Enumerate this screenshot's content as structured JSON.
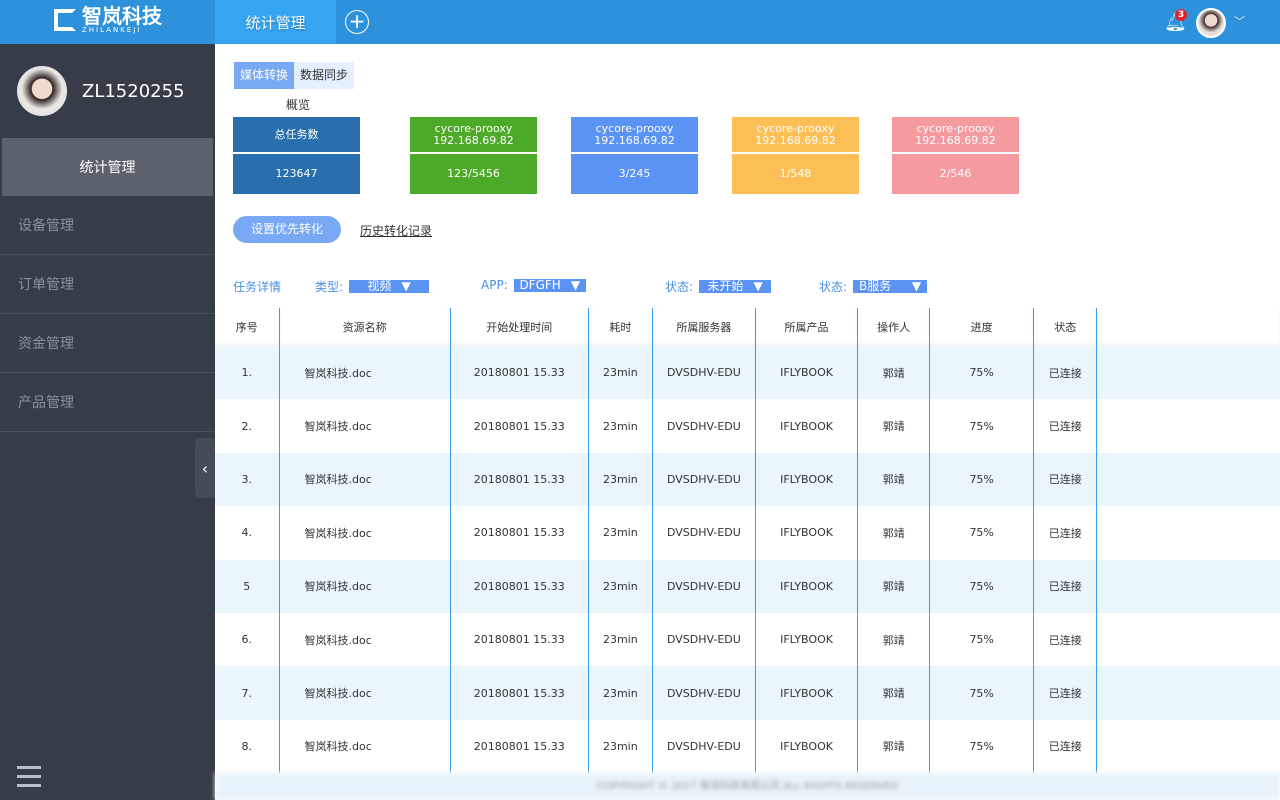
{
  "header": {
    "logo_text": "智岚科技",
    "logo_sub": "ZHILANKEJI",
    "active_tab": "统计管理",
    "notification_count": "3",
    "colors": {
      "bar": "#2d91db",
      "active_tab": "#36a6f2"
    }
  },
  "sidebar": {
    "username": "ZL1520255",
    "items": [
      {
        "label": "统计管理",
        "active": true
      },
      {
        "label": "设备管理"
      },
      {
        "label": "订单管理"
      },
      {
        "label": "资金管理"
      },
      {
        "label": "产品管理"
      }
    ]
  },
  "subtabs": [
    {
      "label": "媒体转换",
      "active": true
    },
    {
      "label": "数据同步"
    }
  ],
  "overview": {
    "label": "概览",
    "cards": [
      {
        "top": "总任务数",
        "top2": "",
        "bottom": "123647",
        "color": "#2a6fad"
      },
      {
        "top": "cycore-prooxy",
        "top2": "192.168.69.82",
        "bottom": "123/5456",
        "color": "#4caa28"
      },
      {
        "top": "cycore-prooxy",
        "top2": "192.168.69.82",
        "bottom": "3/245",
        "color": "#5b93f5"
      },
      {
        "top": "cycore-prooxy",
        "top2": "192.168.69.82",
        "bottom": "1/548",
        "color": "#fbbf55"
      },
      {
        "top": "cycore-prooxy",
        "top2": "192.168.69.82",
        "bottom": "2/546",
        "color": "#f59ba0"
      }
    ]
  },
  "actions": {
    "priority_button": "设置优先转化",
    "history_link": "历史转化记录"
  },
  "filters": {
    "title": "任务详情",
    "items": [
      {
        "label": "类型:",
        "value": "视频"
      },
      {
        "label": "APP:",
        "value": "DFGFH"
      },
      {
        "label": "状态:",
        "value": "未开始"
      },
      {
        "label": "状态:",
        "value": "B服务器"
      }
    ]
  },
  "table": {
    "columns": [
      "序号",
      "资源名称",
      "开始处理时间",
      "耗时",
      "所属服务器",
      "所属产品",
      "操作人",
      "进度",
      "状态",
      ""
    ],
    "rows": [
      [
        "1.",
        "智岚科技.doc",
        "20180801 15.33",
        "23min",
        "DVSDHV-EDU",
        "IFLYBOOK",
        "郭靖",
        "75%",
        "已连接",
        ""
      ],
      [
        "2.",
        "智岚科技.doc",
        "20180801 15.33",
        "23min",
        "DVSDHV-EDU",
        "IFLYBOOK",
        "郭靖",
        "75%",
        "已连接",
        ""
      ],
      [
        "3.",
        "智岚科技.doc",
        "20180801 15.33",
        "23min",
        "DVSDHV-EDU",
        "IFLYBOOK",
        "郭靖",
        "75%",
        "已连接",
        ""
      ],
      [
        "4.",
        "智岚科技.doc",
        "20180801 15.33",
        "23min",
        "DVSDHV-EDU",
        "IFLYBOOK",
        "郭靖",
        "75%",
        "已连接",
        ""
      ],
      [
        "5",
        "智岚科技.doc",
        "20180801 15.33",
        "23min",
        "DVSDHV-EDU",
        "IFLYBOOK",
        "郭靖",
        "75%",
        "已连接",
        ""
      ],
      [
        "6.",
        "智岚科技.doc",
        "20180801 15.33",
        "23min",
        "DVSDHV-EDU",
        "IFLYBOOK",
        "郭靖",
        "75%",
        "已连接",
        ""
      ],
      [
        "7.",
        "智岚科技.doc",
        "20180801 15.33",
        "23min",
        "DVSDHV-EDU",
        "IFLYBOOK",
        "郭靖",
        "75%",
        "已连接",
        ""
      ],
      [
        "8.",
        "智岚科技.doc",
        "20180801 15.33",
        "23min",
        "DVSDHV-EDU",
        "IFLYBOOK",
        "郭靖",
        "75%",
        "已连接",
        ""
      ]
    ]
  },
  "footer": {
    "text": "COPYRIGHT © 2017 智岚科技有限公司 ALL RIGHTS RESERVED"
  }
}
